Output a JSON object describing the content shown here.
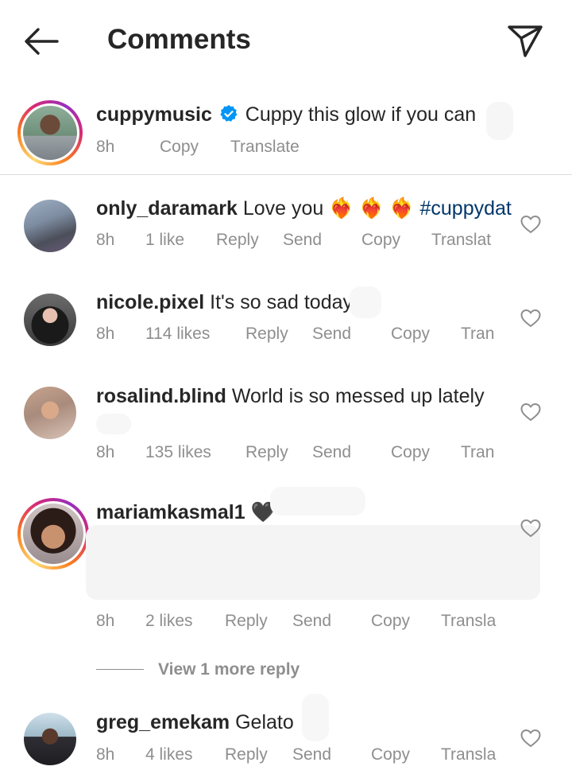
{
  "header": {
    "title": "Comments"
  },
  "caption": {
    "username": "cuppymusic",
    "text": "Cuppy this glow if you can",
    "time": "8h",
    "copy": "Copy",
    "translate": "Translate"
  },
  "comments": [
    {
      "username": "only_daramark",
      "text": "Love you",
      "emoji": "❤️‍🔥 ❤️‍🔥 ❤️‍🔥",
      "hashtag": "#cuppydat",
      "time": "8h",
      "likes": "1 like",
      "reply": "Reply",
      "send": "Send",
      "copy": "Copy",
      "translate": "Translat"
    },
    {
      "username": "nicole.pixel",
      "text": "It's so sad today",
      "time": "8h",
      "likes": "114 likes",
      "reply": "Reply",
      "send": "Send",
      "copy": "Copy",
      "translate": "Tran"
    },
    {
      "username": "rosalind.blind",
      "text": "World is so messed up lately",
      "time": "8h",
      "likes": "135 likes",
      "reply": "Reply",
      "send": "Send",
      "copy": "Copy",
      "translate": "Tran"
    },
    {
      "username": "mariamkasmal1",
      "emoji": "🖤",
      "time": "8h",
      "likes": "2 likes",
      "reply": "Reply",
      "send": "Send",
      "copy": "Copy",
      "translate": "Transla"
    },
    {
      "username": "greg_emekam",
      "text": "Gelato",
      "time": "8h",
      "likes": "4 likes",
      "reply": "Reply",
      "send": "Send",
      "copy": "Copy",
      "translate": "Transla"
    }
  ],
  "view_more": "View 1 more reply",
  "colors": {
    "verified": "#0095f6",
    "hashtag": "#00376b",
    "meta": "#8e8e8e"
  },
  "icons": [
    "back-arrow-icon",
    "direct-send-icon",
    "verified-badge-icon",
    "heart-outline-icon"
  ]
}
